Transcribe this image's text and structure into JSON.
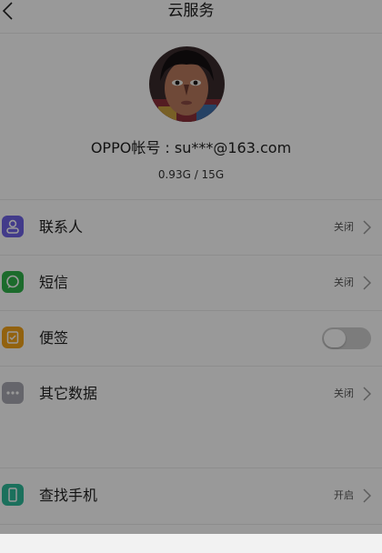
{
  "header": {
    "title": "云服务",
    "back_icon": "back-arrow-icon"
  },
  "profile": {
    "account_text": "OPPO帐号 : su***@163.com",
    "storage_text": "0.93G / 15G"
  },
  "items": [
    {
      "label": "联系人",
      "status": "关闭",
      "icon": "contacts-icon",
      "color": "#6f63e6",
      "control": "chevron"
    },
    {
      "label": "短信",
      "status": "关闭",
      "icon": "message-icon",
      "color": "#2fb24a",
      "control": "chevron"
    },
    {
      "label": "便签",
      "status": "",
      "icon": "notes-icon",
      "color": "#f4a31a",
      "control": "toggle",
      "toggle_on": false
    },
    {
      "label": "其它数据",
      "status": "关闭",
      "icon": "more-data-icon",
      "color": "#a9a9b2",
      "control": "chevron"
    },
    {
      "label": "查找手机",
      "status": "开启",
      "icon": "find-phone-icon",
      "color": "#2dbb9a",
      "control": "chevron"
    }
  ],
  "colors": {
    "overlay": "rgba(0,0,0,0.40)",
    "divider": "#ececec"
  }
}
